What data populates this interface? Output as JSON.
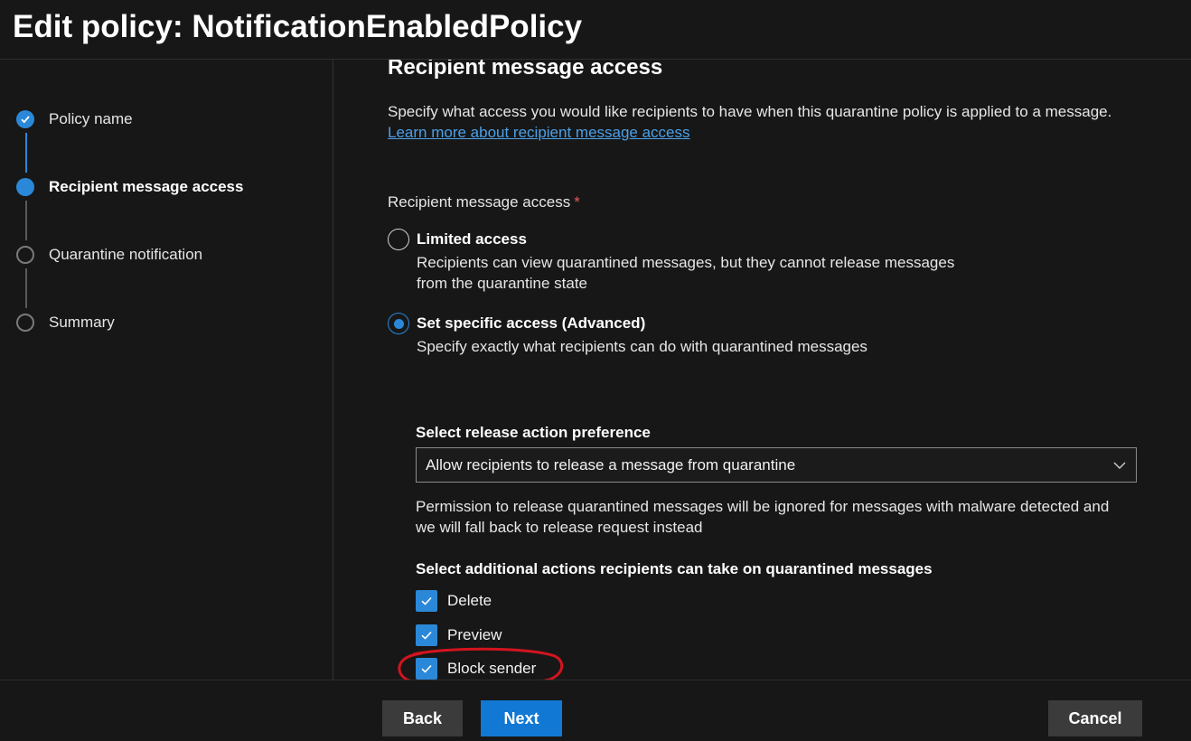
{
  "header": {
    "title": "Edit policy: NotificationEnabledPolicy"
  },
  "steps": [
    {
      "label": "Policy name",
      "state": "done"
    },
    {
      "label": "Recipient message access",
      "state": "current"
    },
    {
      "label": "Quarantine notification",
      "state": "todo"
    },
    {
      "label": "Summary",
      "state": "todo"
    }
  ],
  "main": {
    "title": "Recipient message access",
    "description": "Specify what access you would like recipients to have when this quarantine policy is applied to a message.",
    "learn_more": "Learn more about recipient message access",
    "field_label": "Recipient message access",
    "required_mark": "*",
    "options": [
      {
        "title": "Limited access",
        "desc_line1": "Recipients can view quarantined messages, but they cannot release messages",
        "desc_line2": "from the quarantine state",
        "selected": false
      },
      {
        "title": "Set specific access (Advanced)",
        "desc_line1": "Specify exactly what recipients can do with quarantined messages",
        "selected": true
      }
    ],
    "release_label": "Select release action preference",
    "release_value": "Allow recipients to release a message from quarantine",
    "note_line1": "Permission to release quarantined messages will be ignored for messages with malware detected and",
    "note_line2": "we will fall back to release request instead",
    "actions_label": "Select additional actions recipients can take on quarantined messages",
    "actions": [
      {
        "label": "Delete",
        "checked": true
      },
      {
        "label": "Preview",
        "checked": true
      },
      {
        "label": "Block sender",
        "checked": true
      }
    ]
  },
  "footer": {
    "back": "Back",
    "next": "Next",
    "cancel": "Cancel"
  },
  "colors": {
    "accent": "#2b88d8",
    "annotation": "#d4141e",
    "background": "#171717"
  }
}
